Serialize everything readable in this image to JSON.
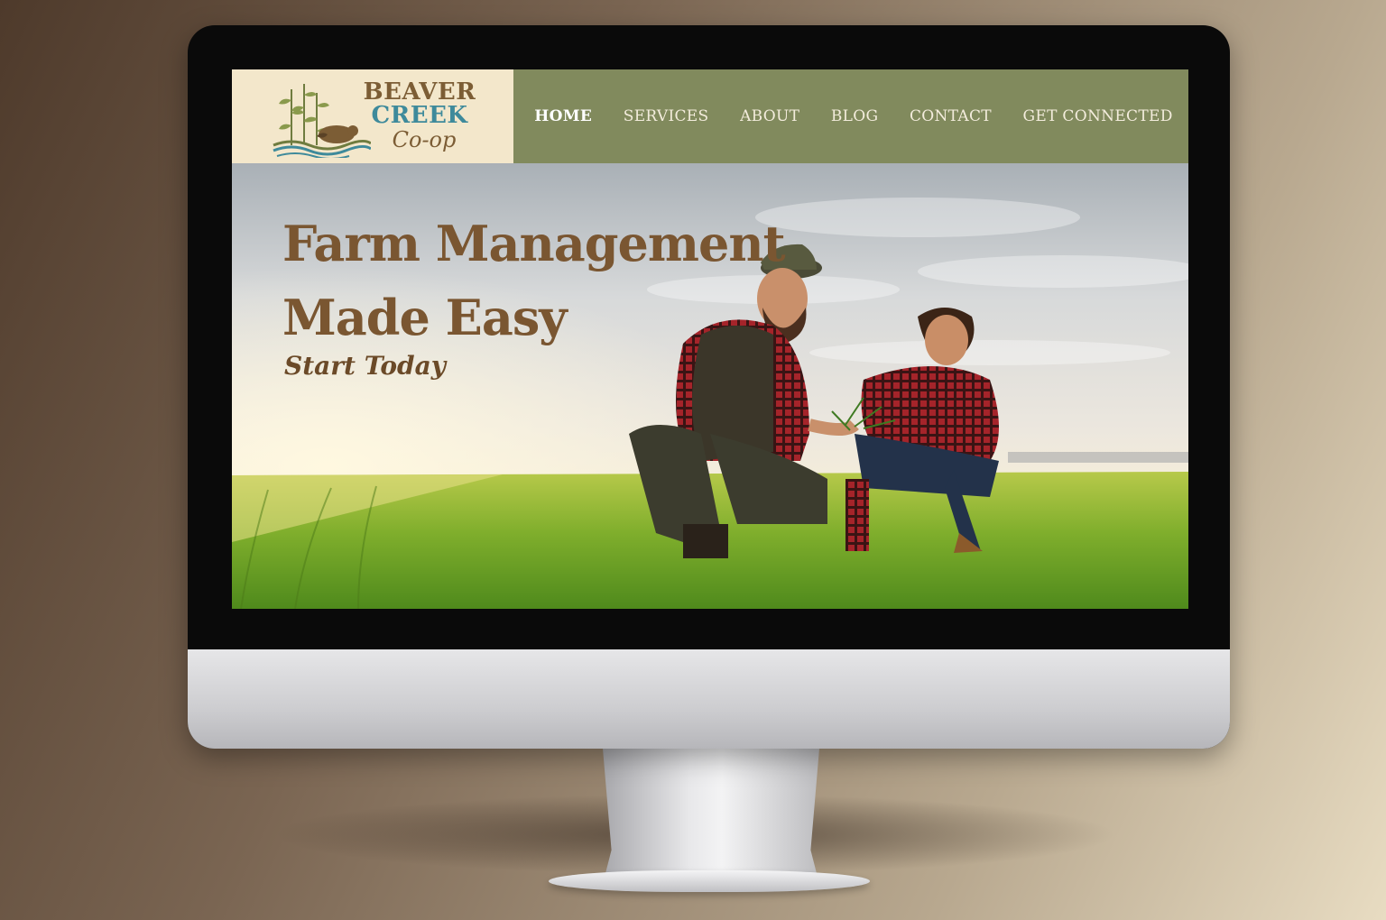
{
  "brand": {
    "line1": "BEAVER",
    "line2": "CREEK",
    "line3": "Co-op",
    "colors": {
      "brown": "#7c5d35",
      "teal": "#3e8a9b",
      "cream": "#f3e7cb"
    }
  },
  "nav": {
    "background": "#818a5d",
    "items": [
      {
        "label": "HOME",
        "active": true
      },
      {
        "label": "SERVICES"
      },
      {
        "label": "ABOUT"
      },
      {
        "label": "BLOG"
      },
      {
        "label": "CONTACT"
      },
      {
        "label": "GET CONNECTED"
      }
    ]
  },
  "hero": {
    "headline_line1": "Farm Management",
    "headline_line2": "Made Easy",
    "cta_label": "Start Today",
    "text_color": "#7a5631"
  }
}
